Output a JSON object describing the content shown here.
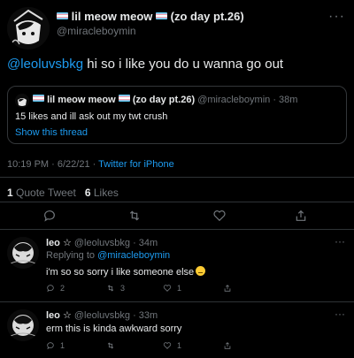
{
  "tweet": {
    "display_name": "lil meow meow",
    "name_suffix": "(zo day pt.26)",
    "handle": "@miracleboymin",
    "mention": "@leoluvsbkg",
    "text": " hi so i like you do u wanna go out",
    "timestamp": "10:19 PM · 6/22/21 · ",
    "source": "Twitter for iPhone",
    "quote_tweets_count": "1",
    "quote_tweets_label": " Quote Tweet",
    "likes_count": "6",
    "likes_label": " Likes"
  },
  "quote": {
    "display_name": "lil meow meow",
    "name_suffix": "(zo day pt.26)",
    "handle_time": "@miracleboymin · 38m",
    "text": "15 likes and ill ask out my twt crush",
    "show_thread": "Show this thread"
  },
  "replies": [
    {
      "display_name": "leo ☆",
      "handle_time": "@leoluvsbkg · 34m",
      "replying_prefix": "Replying to ",
      "replying_to": "@miracleboymin",
      "text": "i'm so so sorry i like someone else",
      "reply_count": "2",
      "retweet_count": "3",
      "like_count": "1"
    },
    {
      "display_name": "leo ☆",
      "handle_time": "@leoluvsbkg · 33m",
      "text": "erm this is kinda awkward sorry",
      "reply_count": "1",
      "retweet_count": "",
      "like_count": "1"
    }
  ],
  "colors": {
    "background": "#000000",
    "text": "#e7e9ea",
    "muted": "#71767b",
    "link": "#1d9bf0",
    "divider": "#2f3336"
  },
  "icons": {
    "more": "more-horizontal-icon",
    "reply": "reply-bubble-icon",
    "retweet": "retweet-icon",
    "like": "heart-icon",
    "share": "share-icon",
    "flag": "trans-flag-icon"
  }
}
